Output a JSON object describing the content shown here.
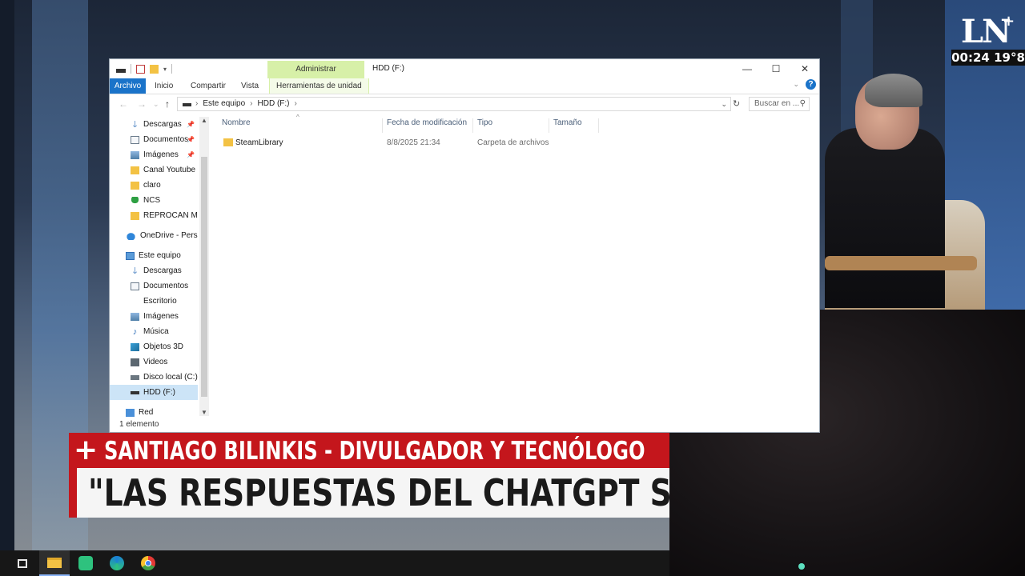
{
  "broadcast": {
    "logo_text": "LN",
    "logo_plus": "+",
    "clock": "00:24 19°8",
    "lower_third_top": "SANTIAGO BILINKIS - DIVULGADOR Y TECNÓLOGO",
    "lower_third_plus": "+",
    "lower_third_bottom": "\"LAS RESPUESTAS DEL CHATGPT SON"
  },
  "window": {
    "context_tab": "Administrar",
    "title": "HDD (F:)",
    "controls": {
      "minimize": "—",
      "maximize": "☐",
      "close": "✕"
    }
  },
  "ribbon": {
    "tabs": [
      "Archivo",
      "Inicio",
      "Compartir",
      "Vista"
    ],
    "context_sub_tab": "Herramientas de unidad",
    "help": "?"
  },
  "address": {
    "crumbs": [
      "Este equipo",
      "HDD (F:)"
    ],
    "search_placeholder": "Buscar en ..."
  },
  "nav": {
    "quick_access": [
      {
        "label": "Descargas",
        "icon": "download-icon",
        "pinned": true
      },
      {
        "label": "Documentos",
        "icon": "document-icon",
        "pinned": true
      },
      {
        "label": "Imágenes",
        "icon": "pictures-icon",
        "pinned": true
      },
      {
        "label": "Canal Youtube",
        "icon": "folder-icon",
        "pinned": false
      },
      {
        "label": "claro",
        "icon": "folder-icon",
        "pinned": false
      },
      {
        "label": "NCS",
        "icon": "tree-icon",
        "pinned": false
      },
      {
        "label": "REPROCAN MOI",
        "icon": "folder-icon",
        "pinned": false
      }
    ],
    "onedrive": "OneDrive - Persor",
    "this_pc": "Este equipo",
    "this_pc_items": [
      {
        "label": "Descargas",
        "icon": "download-icon"
      },
      {
        "label": "Documentos",
        "icon": "document-icon"
      },
      {
        "label": "Escritorio",
        "icon": "desktop-icon"
      },
      {
        "label": "Imágenes",
        "icon": "pictures-icon"
      },
      {
        "label": "Música",
        "icon": "music-icon"
      },
      {
        "label": "Objetos 3D",
        "icon": "3d-objects-icon"
      },
      {
        "label": "Videos",
        "icon": "video-icon"
      },
      {
        "label": "Disco local (C:)",
        "icon": "disk-icon"
      },
      {
        "label": "HDD (F:)",
        "icon": "hdd-icon",
        "selected": true
      }
    ],
    "network": "Red"
  },
  "content": {
    "columns": [
      "Nombre",
      "Fecha de modificación",
      "Tipo",
      "Tamaño"
    ],
    "rows": [
      {
        "name": "SteamLibrary",
        "modified": "8/8/2025 21:34",
        "type": "Carpeta de archivos",
        "size": ""
      }
    ]
  },
  "status": {
    "item_count": "1 elemento"
  },
  "taskbar": {
    "items": [
      "task-view-icon",
      "file-explorer-icon",
      "green-app-icon",
      "edge-icon",
      "chrome-icon"
    ],
    "active_color": "#8ab4f8"
  },
  "colors": {
    "ln_red": "#c4161c",
    "ribbon_file_blue": "#1a73c9",
    "context_tab_green": "#d7f0a8",
    "selection_blue": "#cce4f7"
  }
}
